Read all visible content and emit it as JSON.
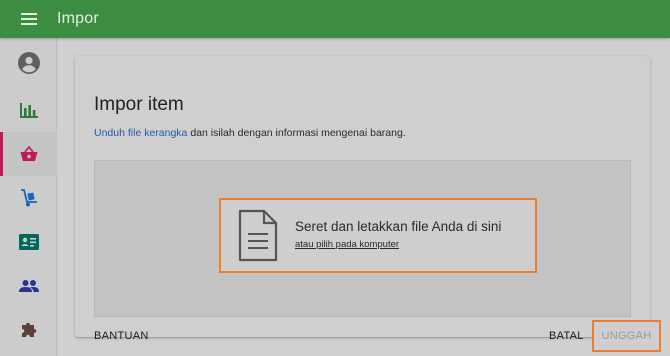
{
  "appbar": {
    "title": "Impor",
    "menu_icon": "hamburger-menu-icon"
  },
  "sidebar": {
    "items": [
      {
        "name": "account",
        "icon": "account-circle-icon",
        "color": "#5f5f5f",
        "active": false
      },
      {
        "name": "reports",
        "icon": "bar-chart-icon",
        "color": "#2e7d32",
        "active": false
      },
      {
        "name": "sales",
        "icon": "basket-icon",
        "color": "#c2185b",
        "active": true
      },
      {
        "name": "inventory",
        "icon": "hand-truck-icon",
        "color": "#1565c0",
        "active": false
      },
      {
        "name": "contacts",
        "icon": "contact-card-icon",
        "color": "#00695c",
        "active": false
      },
      {
        "name": "people",
        "icon": "people-icon",
        "color": "#283593",
        "active": false
      },
      {
        "name": "extensions",
        "icon": "puzzle-icon",
        "color": "#5d4037",
        "active": false
      }
    ]
  },
  "card": {
    "title": "Impor item",
    "description_link": "Unduh file kerangka",
    "description_text": " dan isilah dengan informasi mengenai barang.",
    "dropzone": {
      "main_text": "Seret dan letakkan file Anda di sini",
      "link_text": "atau pilih pada komputer",
      "icon": "document-icon"
    },
    "buttons": {
      "help": "BANTUAN",
      "cancel": "BATAL",
      "upload": "UNGGAH"
    }
  },
  "colors": {
    "appbar": "#3b8e3f",
    "highlight": "#ed7d31",
    "link": "#1f5e9f",
    "active_indicator": "#c2185b"
  }
}
